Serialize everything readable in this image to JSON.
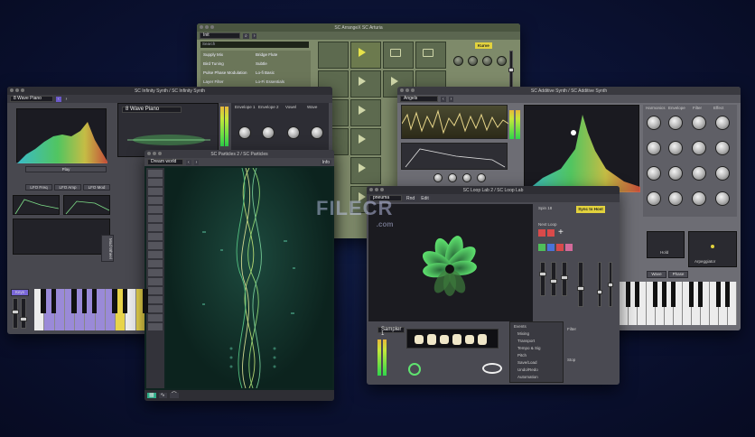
{
  "watermark": {
    "brand_main": "FILECR",
    "brand_sub": ".com"
  },
  "win_arp": {
    "title": "SC ArrangeX SC Arturia",
    "preset": "Init",
    "search_placeholder": "Search",
    "rows": [
      {
        "name": "Supply Mix",
        "type": "Bridge Flute"
      },
      {
        "name": "Bird Tuning",
        "type": "Subtle"
      },
      {
        "name": "Pulse Phase Modulation",
        "type": "Lo-fi Basic"
      },
      {
        "name": "Layer Filter",
        "type": "Lo-Fi Essentials"
      }
    ],
    "chip": "Kurve"
  },
  "win_infinity": {
    "title": "SC Infinity Synth / SC Infinity Synth",
    "preset": "8 Wave Piano",
    "preset2": "8 Wave Piano",
    "sections": [
      "Envelope 1",
      "Envelope 2",
      "Vowel",
      "Wave"
    ],
    "play_label": "Play",
    "mod_labels": [
      "LFO Freq",
      "LFO Amp",
      "LFO Mod"
    ],
    "mod_wheel": "Mod Wheel",
    "key_label": "Keys"
  },
  "win_additive": {
    "title": "SC Additive Synth / SC Additive Synth",
    "preset": "Angels",
    "sections": [
      "Harmonics",
      "Envelope",
      "Filter",
      "Effect"
    ],
    "buttons": [
      "Wave",
      "Phase"
    ],
    "hold": "Hold",
    "arp": "Arpeggiator"
  },
  "win_particles": {
    "title": "SC Particles 2 / SC Particles",
    "preset": "Dream world",
    "chip": "Info"
  },
  "win_loop": {
    "title": "SC Loop Lab 2 / SC Loop Lab",
    "preset": "pneuma",
    "buttons": [
      "Rnd",
      "Edit"
    ],
    "tag": "Sync to Host",
    "side": [
      "Spin 18",
      "Next Loop"
    ],
    "sampler": "Sampler 1",
    "list_title": "Events",
    "list": [
      "Mixing",
      "Transport",
      "Tempo & Sig",
      "Pitch",
      "Save/Load",
      "Undo/Redo",
      "Automation"
    ],
    "right_title": "Filter",
    "right_label": "Stop"
  }
}
